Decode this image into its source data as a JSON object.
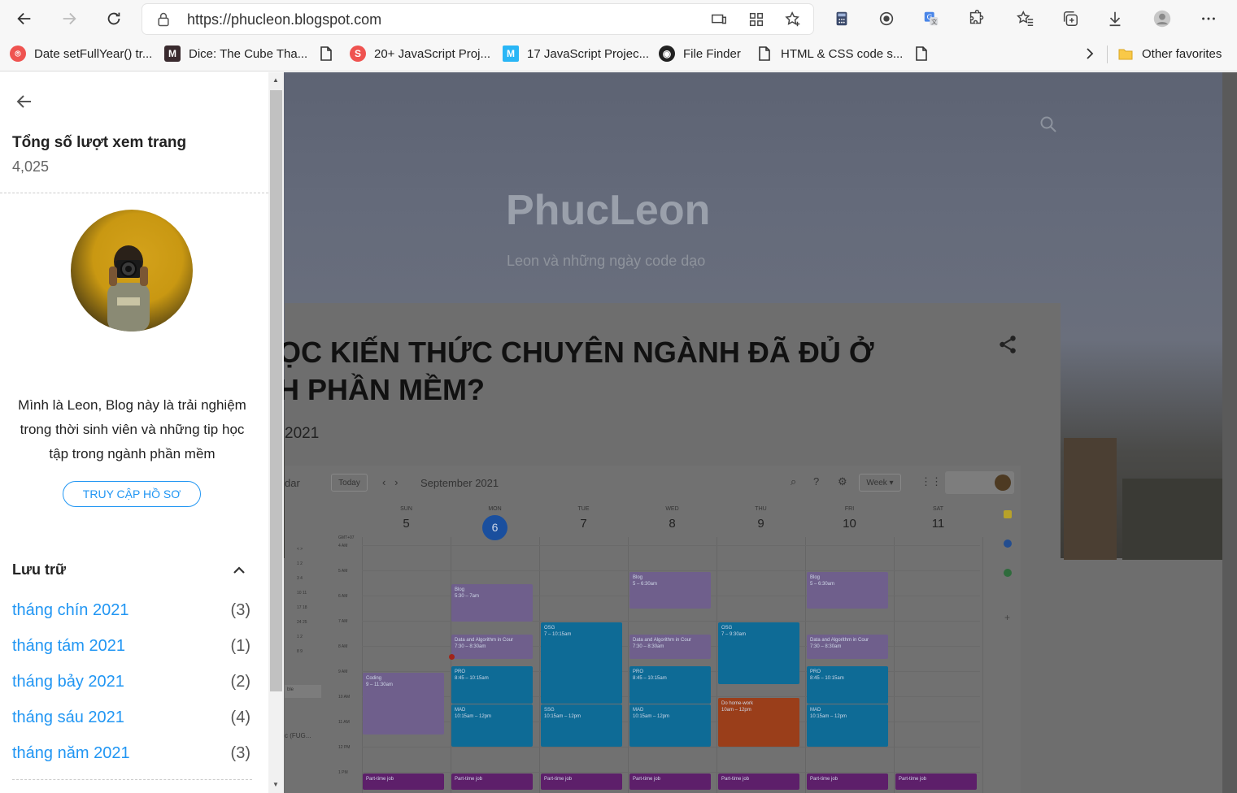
{
  "browser": {
    "url": "https://phucleon.blogspot.com",
    "bookmarks": [
      {
        "label": "Date setFullYear() tr...",
        "icon": "red-circle-icon"
      },
      {
        "label": "Dice: The Cube Tha...",
        "icon": "m-logo-icon"
      },
      {
        "label": "",
        "icon": "page-icon"
      },
      {
        "label": "20+ JavaScript Proj...",
        "icon": "red-s-icon"
      },
      {
        "label": "17 JavaScript Projec...",
        "icon": "m-blue-icon"
      },
      {
        "label": "File Finder",
        "icon": "github-icon"
      },
      {
        "label": "HTML & CSS code s...",
        "icon": "page-icon"
      },
      {
        "label": "",
        "icon": "page-icon"
      }
    ],
    "other_favorites": "Other favorites"
  },
  "sidebar": {
    "stats_title": "Tổng số lượt xem trang",
    "stats_value": "4,025",
    "about": "Mình là Leon, Blog này là trải nghiệm trong thời sinh viên và những tip học tập trong ngành phần mềm",
    "profile_button": "TRUY CẬP HỒ SƠ",
    "archive_title": "Lưu trữ",
    "archive": [
      {
        "label": "tháng chín 2021",
        "count": "(3)"
      },
      {
        "label": "tháng tám 2021",
        "count": "(1)"
      },
      {
        "label": "tháng bảy 2021",
        "count": "(2)"
      },
      {
        "label": "tháng sáu 2021",
        "count": "(4)"
      },
      {
        "label": "tháng năm 2021",
        "count": "(3)"
      }
    ]
  },
  "blog": {
    "title": "PhucLeon",
    "subtitle": "Leon và những ngày code dạo",
    "post_title_line1": "ỌC KIẾN THỨC CHUYÊN NGÀNH ĐÃ ĐỦ Ở",
    "post_title_line2": "H PHẦN MỀM?",
    "post_date": "2021"
  },
  "calendar": {
    "label_left": "dar",
    "today": "Today",
    "month": "September 2021",
    "view": "Week",
    "timezone": "GMT+07",
    "days": [
      {
        "name": "SUN",
        "num": "5"
      },
      {
        "name": "MON",
        "num": "6"
      },
      {
        "name": "TUE",
        "num": "7"
      },
      {
        "name": "WED",
        "num": "8"
      },
      {
        "name": "THU",
        "num": "9"
      },
      {
        "name": "FRI",
        "num": "10"
      },
      {
        "name": "SAT",
        "num": "11"
      }
    ],
    "times": [
      "4 AM",
      "5 AM",
      "6 AM",
      "7 AM",
      "8 AM",
      "9 AM",
      "10 AM",
      "11 AM",
      "12 PM",
      "1 PM"
    ],
    "events": {
      "blog_mon": {
        "title": "Blog",
        "time": "5:30 – 7am"
      },
      "blog_wed": {
        "title": "Blog",
        "time": "5 – 6:30am"
      },
      "blog_fri": {
        "title": "Blog",
        "time": "5 – 6:30am"
      },
      "dsa_mon": {
        "title": "Data and Algorithm in Cour",
        "time": "7:30 – 8:30am"
      },
      "dsa_wed": {
        "title": "Data and Algorithm in Cour",
        "time": "7:30 – 8:30am"
      },
      "dsa_fri": {
        "title": "Data and Algorithm in Cour",
        "time": "7:30 – 8:30am"
      },
      "osg_tue": {
        "title": "OSG",
        "time": "7 – 10:15am"
      },
      "osg_thu": {
        "title": "OSG",
        "time": "7 – 9:30am"
      },
      "pro_mon": {
        "title": "PRO",
        "time": "8:45 – 10:15am"
      },
      "pro_wed": {
        "title": "PRO",
        "time": "8:45 – 10:15am"
      },
      "pro_fri": {
        "title": "PRO",
        "time": "8:45 – 10:15am"
      },
      "coding_sun": {
        "title": "Coding",
        "time": "9 – 11:30am"
      },
      "mad_mon": {
        "title": "MAD",
        "time": "10:15am – 12pm"
      },
      "ssg_tue": {
        "title": "SSG",
        "time": "10:15am – 12pm"
      },
      "mad_wed": {
        "title": "MAD",
        "time": "10:15am – 12pm"
      },
      "homework_thu": {
        "title": "Do home-work",
        "time": "10am – 12pm"
      },
      "mad_fri": {
        "title": "MAD",
        "time": "10:15am – 12pm"
      },
      "parttime": "Part-time job"
    },
    "mini_rows": [
      "< >",
      "1 2",
      "3 4",
      "10 11",
      "17 18",
      "24 25",
      "1 2",
      "8 9"
    ],
    "side_left_1": "ble",
    "side_left_2": "c (FUG..."
  }
}
